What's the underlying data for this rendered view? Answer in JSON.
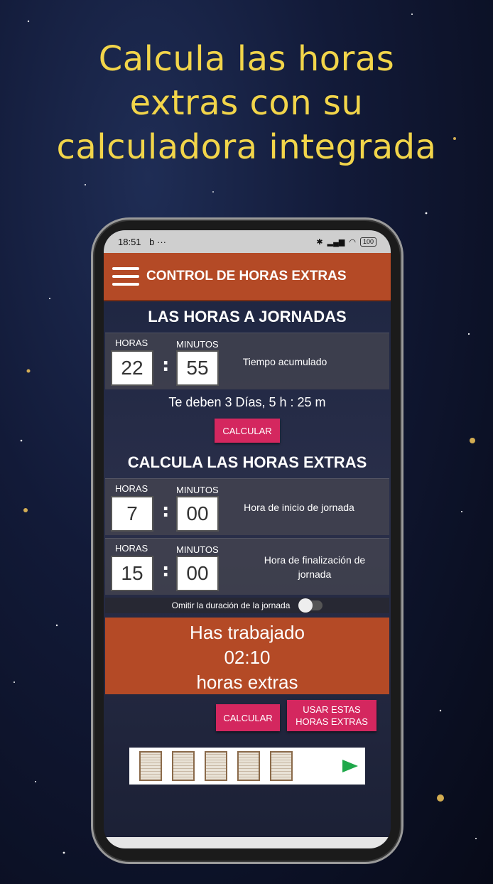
{
  "headline": [
    "Calcula las horas",
    "extras con su",
    "calculadora integrada"
  ],
  "status": {
    "time": "18:51",
    "left_icons": "b ···",
    "battery": "100"
  },
  "appbar": {
    "title": "CONTROL DE HORAS EXTRAS"
  },
  "section1": {
    "title": "LAS HORAS A JORNADAS",
    "horas_label": "HORAS",
    "minutos_label": "MINUTOS",
    "horas": "22",
    "minutos": "55",
    "desc": "Tiempo acumulado",
    "result": "Te deben 3 Días, 5 h : 25 m",
    "calc_button": "CALCULAR"
  },
  "section2": {
    "title": "CALCULA LAS HORAS EXTRAS",
    "start": {
      "horas_label": "HORAS",
      "minutos_label": "MINUTOS",
      "horas": "7",
      "minutos": "00",
      "desc": "Hora de inicio de jornada"
    },
    "end": {
      "horas_label": "HORAS",
      "minutos_label": "MINUTOS",
      "horas": "15",
      "minutos": "00",
      "desc": "Hora de finalización de jornada"
    },
    "toggle_label": "Omitir la duración de la jornada",
    "toggle_on": false,
    "result_line1": "Has trabajado",
    "result_line2": "02:10",
    "result_line3": "horas extras",
    "calc_button": "CALCULAR",
    "use_button": "USAR ESTAS HORAS EXTRAS"
  },
  "colors": {
    "accent": "#b44a26",
    "button": "#d4275f",
    "headline": "#f2d54a"
  }
}
